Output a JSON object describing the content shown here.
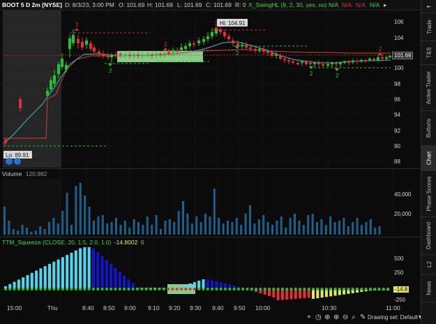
{
  "header": {
    "symbol": "BOOT 5 D 2m [NYSE]",
    "datetime": "D: 8/3/23, 3:00 PM",
    "open": "O: 101.69",
    "high": "H: 101.69",
    "low": "L: 101.69",
    "close": "C: 101.69",
    "range": "R: 0",
    "study": "X_SwingHL (8, 2, 30, yes, no)",
    "na_values": [
      "N/A",
      "N/A",
      "N/A",
      "N/A"
    ]
  },
  "price_axis": {
    "ticks": [
      "106",
      "104",
      "102",
      "100",
      "98",
      "96",
      "94",
      "92",
      "90",
      "88"
    ],
    "last_price": "101.69"
  },
  "annotations": {
    "high": "Hi: 104.91",
    "low": "Lo: 89.91"
  },
  "swing_labels": [
    "2",
    "2",
    "2",
    "2",
    "2",
    "2",
    "2",
    "3"
  ],
  "volume": {
    "label": "Volume",
    "value": "120,982",
    "ticks": [
      "40,000",
      "20,000"
    ]
  },
  "squeeze": {
    "label": "TTM_Squeeze (CLOSE, 20, 1.5, 2.0, 1.0)",
    "value": "-14.8002",
    "zero": "0",
    "ticks": [
      "500",
      "250",
      "-250"
    ],
    "last_value": "-14.8"
  },
  "time_axis": [
    "15:00",
    "Thu",
    "8:40",
    "8:50",
    "9:00",
    "9:10",
    "9:20",
    "9:30",
    "9:40",
    "9:50",
    "10:00",
    "10:30",
    "11:00"
  ],
  "footer": {
    "drawing_set": "Drawing set: Default"
  },
  "sidebar_tabs": [
    "Trade",
    "T&S",
    "Active Trader",
    "Buttons",
    "Chart",
    "Phase Scores",
    "Dashboard",
    "L2",
    "News"
  ],
  "colors": {
    "up": "#27c227",
    "down": "#e03030",
    "cyan": "#4dd9f0",
    "blue": "#1414c8",
    "volume": "#1f5f8c",
    "ema_red": "#d84030",
    "ema_cyan": "#30c0d0"
  },
  "icons": [
    "add-icon",
    "clock-icon",
    "magnifier-icon",
    "pan-icon",
    "zoom-in-icon",
    "zoom-out-icon",
    "ruler-icon",
    "pencil-icon",
    "settings-icon"
  ]
}
